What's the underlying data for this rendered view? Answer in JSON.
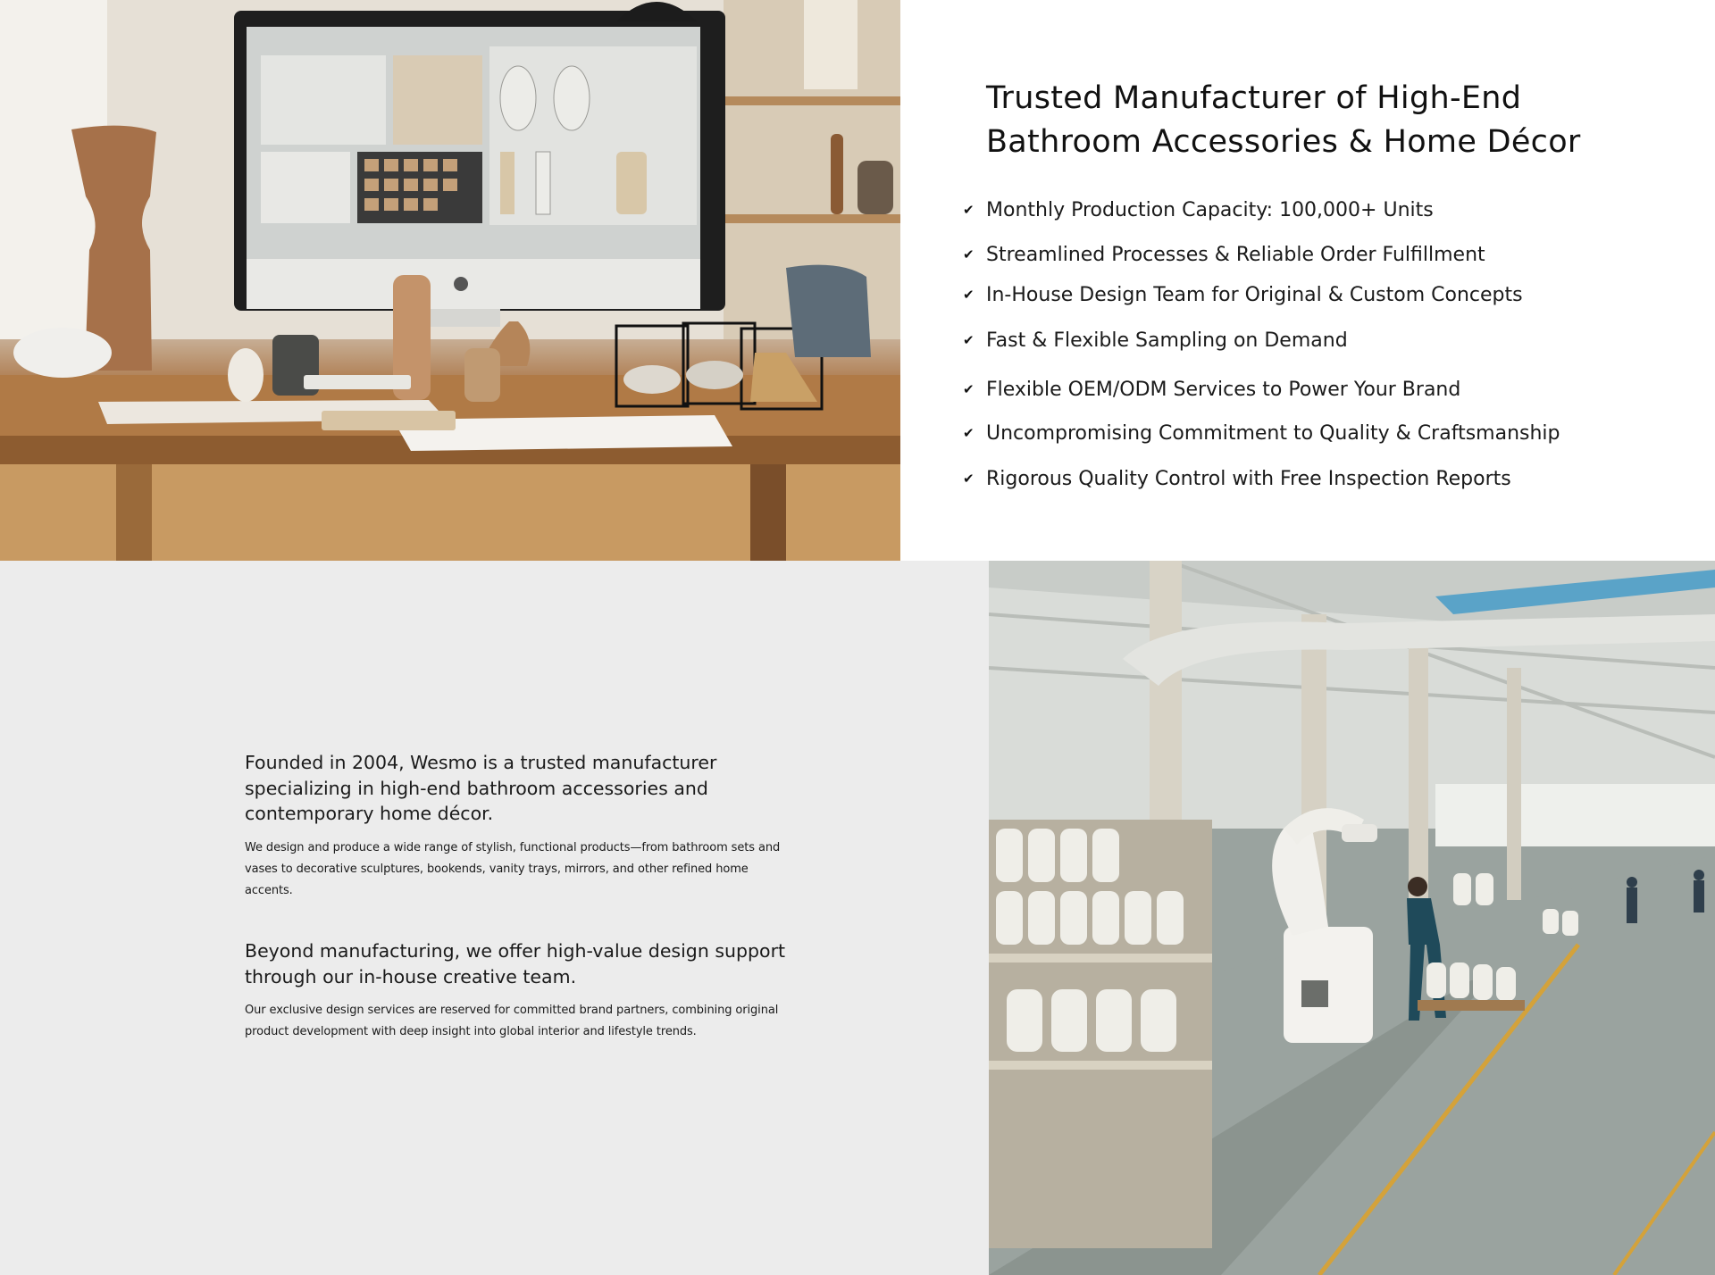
{
  "features": {
    "headline": "Trusted Manufacturer of High-End Bathroom Accessories & Home Décor",
    "check_glyph": "✔",
    "items": [
      "Monthly Production Capacity: 100,000+ Units",
      "Streamlined Processes & Reliable Order Fulfillment",
      "In-House Design Team for Original & Custom Concepts",
      "Fast & Flexible Sampling on Demand",
      "Flexible OEM/ODM Services to Power Your Brand",
      "Uncompromising Commitment to Quality & Craftsmanship",
      "Rigorous Quality Control with Free Inspection Reports"
    ]
  },
  "about": {
    "block1": {
      "lead": "Founded in 2004, Wesmo is a trusted manufacturer specializing in high-end bathroom accessories and contemporary home décor.",
      "body": "We design and produce a wide range of stylish, functional products—from bathroom sets and vases to decorative sculptures, bookends, vanity trays, mirrors, and other refined home accents."
    },
    "block2": {
      "lead": "Beyond manufacturing, we offer high-value design support through our in-house creative team.",
      "body": "Our exclusive design services are reserved for committed brand partners, combining original product development with deep insight into global interior and lifestyle trends."
    }
  },
  "colors": {
    "page_bg": "#ffffff",
    "panel_grey": "#ececec",
    "text": "#1a1a1a",
    "wood": "#a8703f",
    "factory_floor": "#9aa39f",
    "floor_line": "#d4a23a"
  },
  "icons": [
    "check-icon",
    "computer-monitor-icon",
    "pendant-lamp-icon",
    "vase-icon",
    "robot-arm-icon",
    "worker-figure-icon"
  ]
}
